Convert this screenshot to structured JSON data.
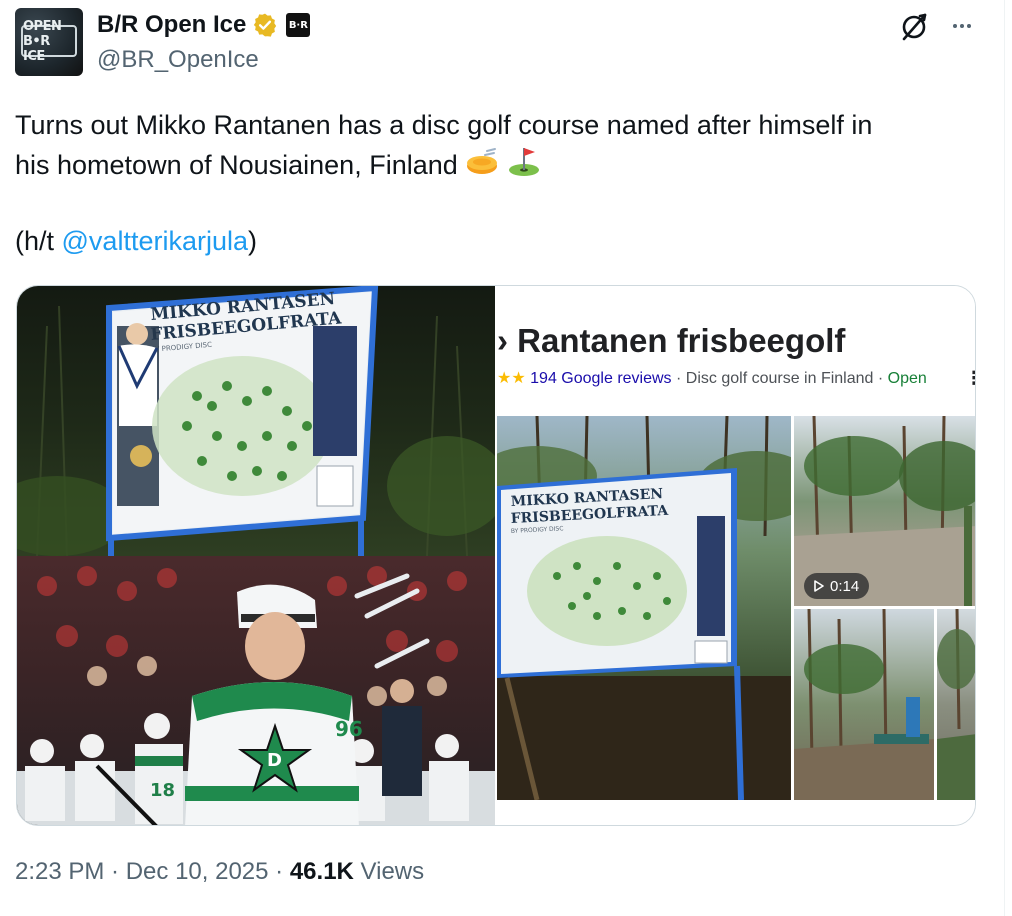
{
  "author": {
    "display_name": "B/R Open Ice",
    "handle": "@BR_OpenIce",
    "avatar_text": "OPEN B•R ICE",
    "affiliate_badge": "B·R",
    "verified_color": "#e8b923"
  },
  "header_actions": {
    "grok_icon": "grok-icon",
    "more_icon": "more-icon"
  },
  "tweet": {
    "text_line1": "Turns out Mikko Rantanen has a disc golf course named after himself in",
    "text_line2": "his hometown of Nousiainen, Finland",
    "emojis": [
      "flying-disc-emoji",
      "flag-in-hole-emoji"
    ],
    "ht_prefix": "(h/t ",
    "mention": "@valtterikarjula",
    "ht_suffix": ")"
  },
  "media": {
    "sign_title_line1": "MIKKO RANTASEN",
    "sign_title_line2": "FRISBEEGOLFRATA",
    "sign_subtitle": "BY PRODIGY DISC",
    "jersey_number": "96",
    "bench_number": "18",
    "google": {
      "title": "Rantanen frisbeegolf",
      "title_prefix": "›",
      "stars": "★★",
      "reviews": "194 Google reviews",
      "separator": " · ",
      "category": "Disc golf course in Finland",
      "status": "Open",
      "kebab": "⋮",
      "video_duration": "0:14",
      "sign_title_line1": "MIKKO RANTASEN",
      "sign_title_line2": "FRISBEEGOLFRATA",
      "sign_subtitle": "BY PRODIGY DISC"
    }
  },
  "footer": {
    "time": "2:23 PM",
    "dot": " · ",
    "date": "Dec 10, 2025",
    "views_count": "46.1K",
    "views_label": " Views"
  },
  "colors": {
    "link": "#1d9bf0",
    "secondary_text": "#536471",
    "primary_text": "#0f1419",
    "google_link": "#1a0dab",
    "google_open": "#188038"
  }
}
